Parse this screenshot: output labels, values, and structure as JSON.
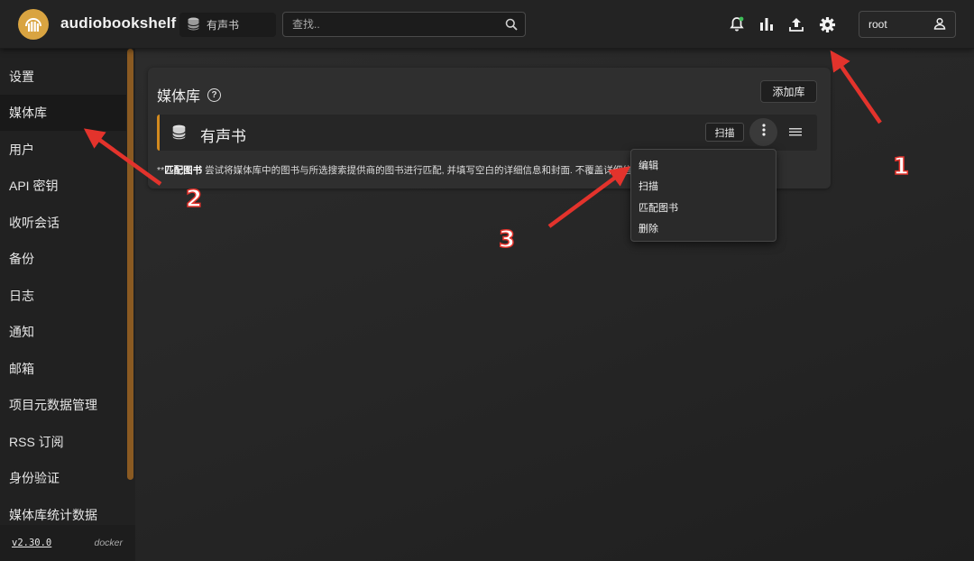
{
  "app": {
    "title": "audiobookshelf",
    "brand_color": "#d9a441"
  },
  "header": {
    "library_select": {
      "value": "有声书",
      "icon": "database-icon"
    },
    "search": {
      "placeholder": "查找.."
    },
    "icons": [
      "bell-icon",
      "stats-icon",
      "upload-icon",
      "gear-icon"
    ],
    "notification_dot_color": "#3fbf5a",
    "user": {
      "name": "root",
      "icon": "user-icon"
    }
  },
  "sidebar": {
    "items": [
      {
        "label": "设置"
      },
      {
        "label": "媒体库"
      },
      {
        "label": "用户"
      },
      {
        "label": "API 密钥"
      },
      {
        "label": "收听会话"
      },
      {
        "label": "备份"
      },
      {
        "label": "日志"
      },
      {
        "label": "通知"
      },
      {
        "label": "邮箱"
      },
      {
        "label": "项目元数据管理"
      },
      {
        "label": "RSS 订阅"
      },
      {
        "label": "身份验证"
      },
      {
        "label": "媒体库统计数据"
      }
    ],
    "active_index": 1,
    "version": "v2.30.0",
    "deployment": "docker"
  },
  "main": {
    "title": "媒体库",
    "add_library_label": "添加库",
    "libraries": [
      {
        "name": "有声书",
        "scan_label": "扫描",
        "accent": "#d38a1e"
      }
    ],
    "match_note_prefix": "**",
    "match_note_bold": "匹配图书",
    "match_note_text": " 尝试将媒体库中的图书与所选搜索提供商的图书进行匹配, 并填写空白的详细信息和封面. 不覆盖详细信息."
  },
  "dropdown": {
    "items": [
      {
        "label": "编辑"
      },
      {
        "label": "扫描"
      },
      {
        "label": "匹配图书"
      },
      {
        "label": "删除"
      }
    ]
  },
  "annotations": {
    "arrow_color": "#e3332c",
    "labels": [
      "1",
      "2",
      "3"
    ]
  }
}
